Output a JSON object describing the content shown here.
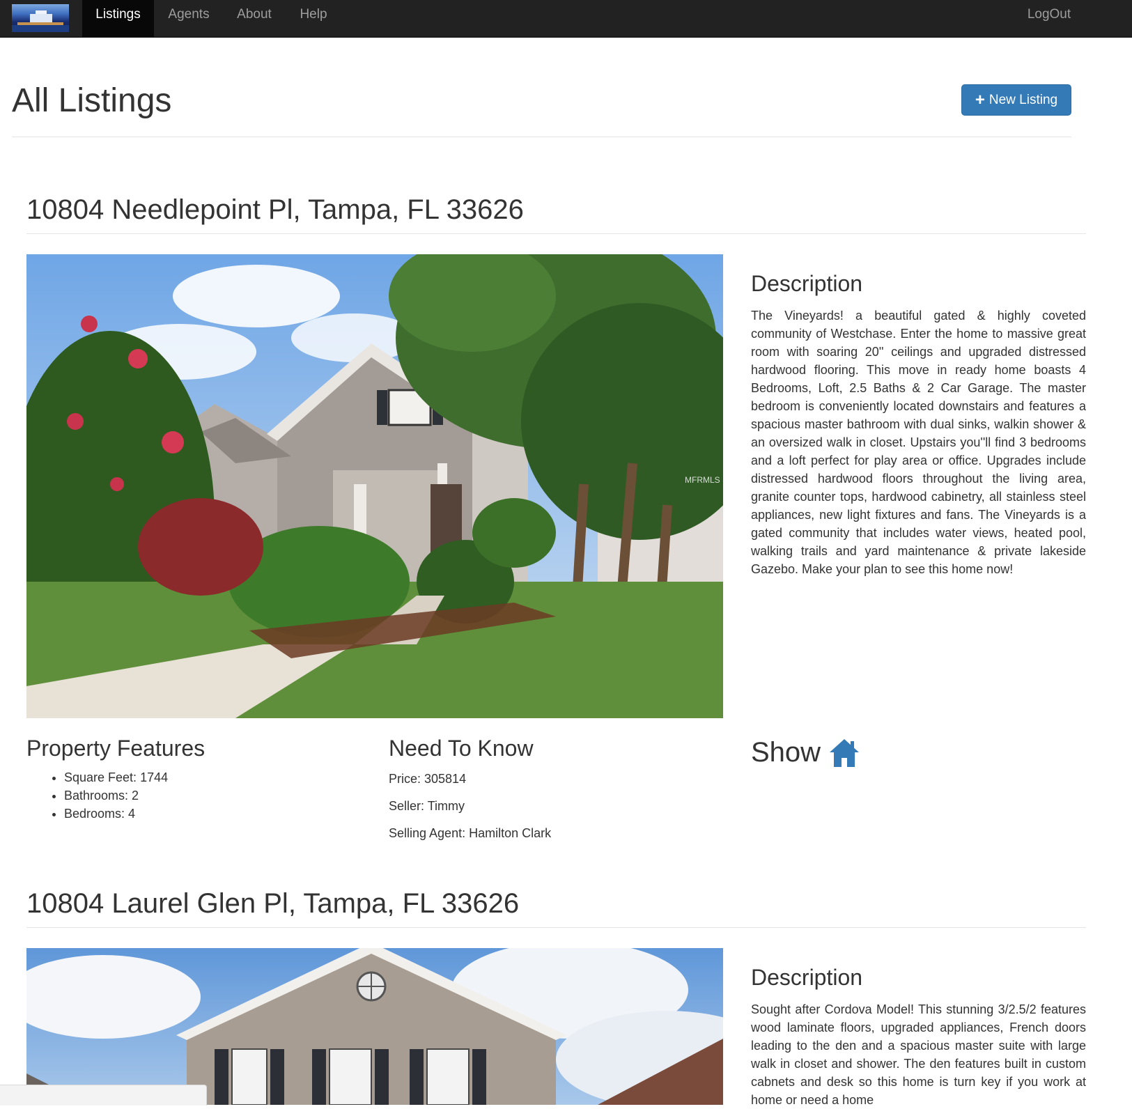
{
  "navbar": {
    "brand_icon": "house-thumbnail-icon",
    "items": [
      {
        "label": "Listings",
        "active": true
      },
      {
        "label": "Agents",
        "active": false
      },
      {
        "label": "About",
        "active": false
      },
      {
        "label": "Help",
        "active": false
      }
    ],
    "logout_label": "LogOut"
  },
  "header": {
    "title": "All Listings",
    "new_listing_label": "New Listing",
    "new_listing_icon": "plus-icon"
  },
  "listings": [
    {
      "address": "10804 Needlepoint Pl, Tampa, FL 33626",
      "photo_watermark": "MFRMLS",
      "description_title": "Description",
      "description": "The Vineyards! a beautiful gated & highly coveted community of Westchase. Enter the home to massive great room with soaring 20'' ceilings and upgraded distressed hardwood flooring. This move in ready home boasts 4 Bedrooms, Loft, 2.5 Baths & 2 Car Garage. The master bedroom is conveniently located downstairs and features a spacious master bathroom with dual sinks, walkin shower & an oversized walk in closet. Upstairs you''ll find 3 bedrooms and a loft perfect for play area or office. Upgrades include distressed hardwood floors throughout the living area, granite counter tops, hardwood cabinetry, all stainless steel appliances, new light fixtures and fans. The Vineyards is a gated community that includes water views, heated pool, walking trails and yard maintenance & private lakeside Gazebo. Make your plan to see this home now!",
      "features_title": "Property Features",
      "features": [
        "Square Feet: 1744",
        "Bathrooms: 2",
        "Bedrooms: 4"
      ],
      "need_to_know_title": "Need To Know",
      "price": "Price: 305814",
      "seller": "Seller: Timmy",
      "agent": "Selling Agent: Hamilton Clark",
      "show_label": "Show",
      "show_icon": "home-icon"
    },
    {
      "address": "10804 Laurel Glen Pl, Tampa, FL 33626",
      "description_title": "Description",
      "description": "Sought after Cordova Model! This stunning 3/2.5/2 features wood laminate floors, upgraded appliances, French doors leading to the den and a spacious master suite with large walk in closet and shower. The den features built in custom cabnets and desk so this home is turn key if you work at home or need a home"
    }
  ],
  "colors": {
    "navbar_bg": "#222222",
    "primary": "#337ab7",
    "text": "#333333"
  }
}
